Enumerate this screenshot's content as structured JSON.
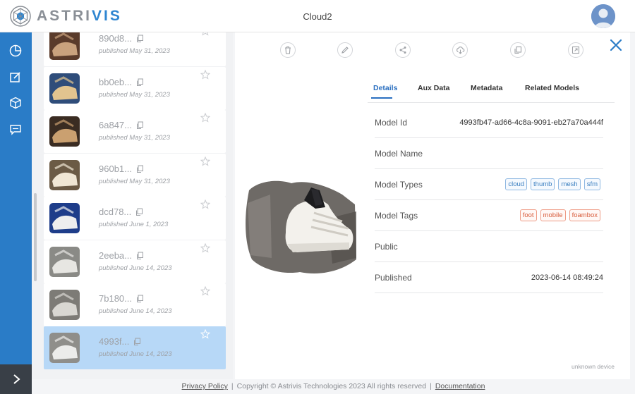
{
  "header": {
    "logo_text_a": "ASTRI",
    "logo_text_b": "VIS",
    "title": "Cloud2"
  },
  "rail": {
    "items": [
      "dashboard-icon",
      "edit-icon",
      "cube-icon",
      "chat-icon"
    ],
    "expand_icon": "chevron-right-icon"
  },
  "models": [
    {
      "id": "890d8...",
      "published": "published May 31, 2023",
      "selected": false
    },
    {
      "id": "bb0eb...",
      "published": "published May 31, 2023",
      "selected": false
    },
    {
      "id": "6a847...",
      "published": "published May 31, 2023",
      "selected": false
    },
    {
      "id": "960b1...",
      "published": "published May 31, 2023",
      "selected": false
    },
    {
      "id": "dcd78...",
      "published": "published June 1, 2023",
      "selected": false
    },
    {
      "id": "2eeba...",
      "published": "published June 14, 2023",
      "selected": false
    },
    {
      "id": "7b180...",
      "published": "published June 14, 2023",
      "selected": false
    },
    {
      "id": "4993f...",
      "published": "published June 14, 2023",
      "selected": true
    }
  ],
  "toolbar": [
    "delete-icon",
    "edit-icon",
    "share-icon",
    "download-icon",
    "copy-icon",
    "open-icon"
  ],
  "tabs": [
    "Details",
    "Aux Data",
    "Metadata",
    "Related Models"
  ],
  "details": {
    "model_id_label": "Model Id",
    "model_id": "4993fb47-ad66-4c8a-9091-eb27a70a444f",
    "model_name_label": "Model Name",
    "model_name": "",
    "model_types_label": "Model Types",
    "model_types": [
      "cloud",
      "thumb",
      "mesh",
      "sfm"
    ],
    "model_tags_label": "Model Tags",
    "model_tags": [
      "foot",
      "mobile",
      "foambox"
    ],
    "public_label": "Public",
    "published_label": "Published",
    "published": "2023-06-14 08:49:24"
  },
  "device": "unknown device",
  "footer": {
    "privacy": "Privacy Policy",
    "copyright": "Copyright © Astrivis Technologies 2023 All rights reserved",
    "docs": "Documentation"
  },
  "colors": {
    "accent": "#2a7cc7",
    "selected": "#b7d8f7",
    "type_chip": "#3b7fc0",
    "tag_chip": "#d75b3b"
  }
}
